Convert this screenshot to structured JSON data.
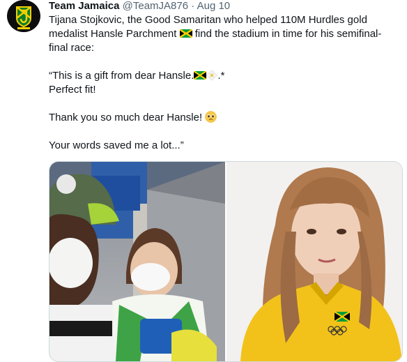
{
  "tweet": {
    "author_name": "Team Jamaica",
    "handle": "@TeamJA876",
    "separator": "·",
    "date": "Aug 10",
    "line1": "Tijana Stojkovic, the Good Samaritan who helped 110M Hurdles gold",
    "line2a": "medalist Hansle Parchment",
    "line2b": "find the stadium in time for his semifinal-",
    "line3": "final race:",
    "quote1": "“This is a gift from dear Hansle.",
    "quote1_end": ".*",
    "quote2": "Perfect fit!",
    "thanks": "Thank you so much dear Hansle!",
    "closing": "Your words saved me a lot...”"
  },
  "icons": {
    "avatar": "team-jamaica-logo",
    "flag": "jamaica-flag-emoji",
    "flower": "white-flower-emoji",
    "face": "pleading-face-emoji"
  },
  "media": {
    "left_image": "selfie-photo",
    "right_image": "portrait-photo"
  },
  "colors": {
    "text": "#0f1419",
    "secondary": "#536471",
    "jamaica_green": "#009b3a",
    "jamaica_gold": "#fed100"
  }
}
